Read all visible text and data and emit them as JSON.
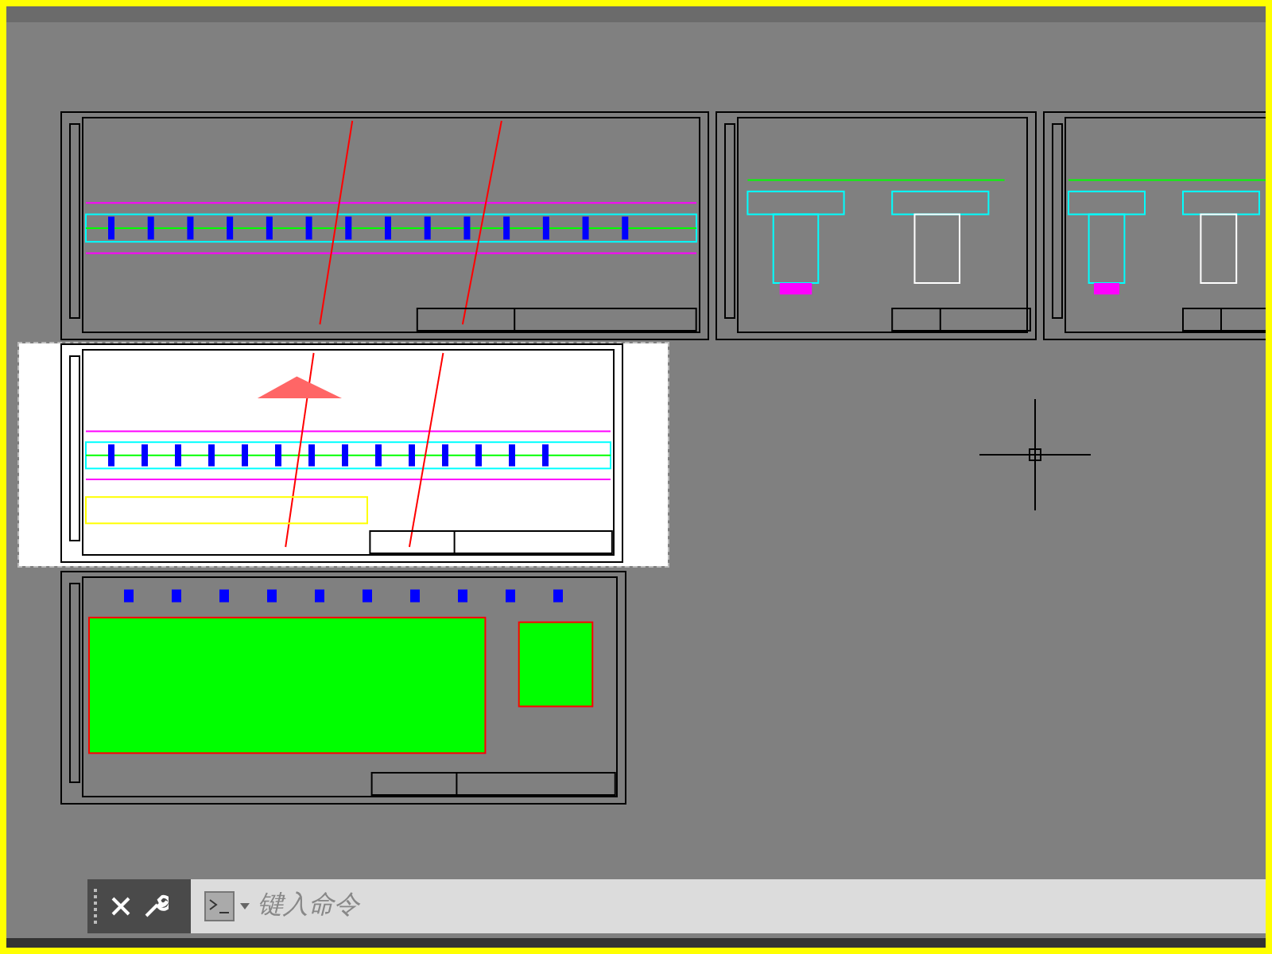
{
  "sheets": [
    {
      "selected": false
    },
    {
      "selected": false
    },
    {
      "selected": false
    },
    {
      "selected": true
    },
    {
      "selected": false
    }
  ],
  "command_line": {
    "placeholder": "键入命令"
  }
}
